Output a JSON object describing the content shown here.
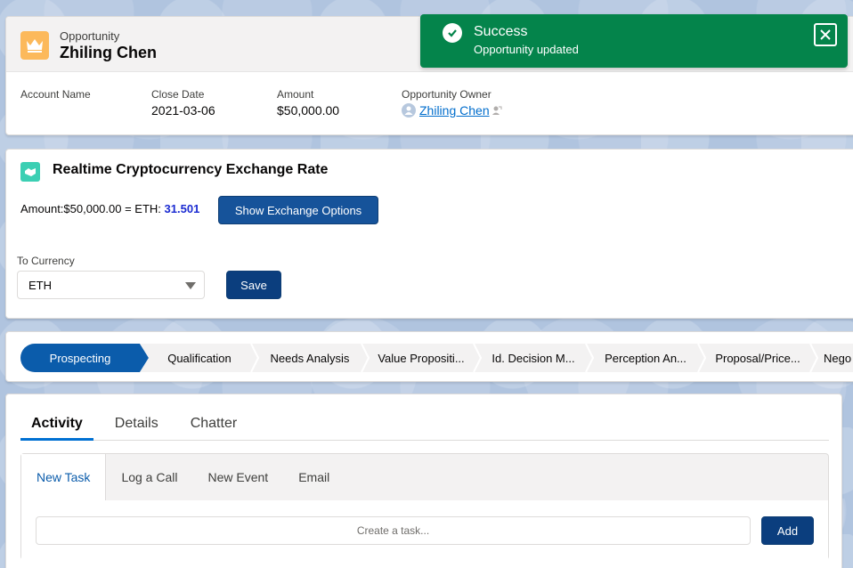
{
  "record": {
    "object_type": "Opportunity",
    "name": "Zhiling Chen",
    "fields": [
      {
        "label": "Account Name",
        "value": ""
      },
      {
        "label": "Close Date",
        "value": "2021-03-06"
      },
      {
        "label": "Amount",
        "value": "$50,000.00"
      },
      {
        "label": "Opportunity Owner",
        "value": "Zhiling Chen"
      }
    ]
  },
  "toast": {
    "title": "Success",
    "message": "Opportunity updated"
  },
  "crypto": {
    "title": "Realtime Cryptocurrency Exchange Rate",
    "amount_prefix": "Amount:$50,000.00 = ETH:",
    "eth_value": "31.501",
    "show_button": "Show Exchange Options",
    "to_currency_label": "To Currency",
    "to_currency_value": "ETH",
    "save_button": "Save"
  },
  "path": {
    "stages": [
      "Prospecting",
      "Qualification",
      "Needs Analysis",
      "Value Propositi...",
      "Id. Decision M...",
      "Perception An...",
      "Proposal/Price...",
      "Nego"
    ],
    "active_index": 0
  },
  "activity": {
    "tabs": [
      "Activity",
      "Details",
      "Chatter"
    ],
    "subtabs": [
      "New Task",
      "Log a Call",
      "New Event",
      "Email"
    ],
    "task_placeholder": "Create a task...",
    "add_button": "Add"
  },
  "colors": {
    "brand": "#0b5cab",
    "toast_success": "#04844b",
    "eth_value": "#1b2bd1",
    "opportunity_icon": "#fcb95b"
  }
}
